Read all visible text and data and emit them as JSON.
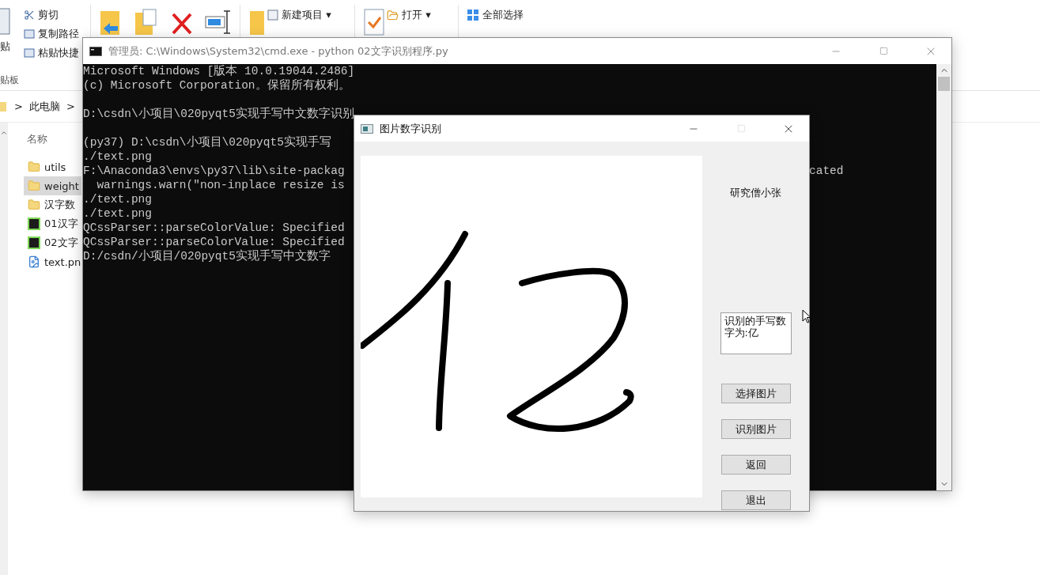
{
  "explorer": {
    "ribbon": {
      "paste_label": "贴",
      "clipboard_items": [
        "剪切",
        "复制路径",
        "粘贴快捷"
      ],
      "clipboard_group": "贴板",
      "new_items": [
        "新建项目 ▾"
      ],
      "open_item": "打开 ▾",
      "select_items": [
        "全部选择"
      ]
    },
    "breadcrumb": [
      ">",
      "此电脑",
      ">"
    ],
    "column_header": "名称",
    "files": [
      {
        "name": "utils",
        "kind": "folder",
        "selected": false
      },
      {
        "name": "weight",
        "kind": "folder",
        "selected": true
      },
      {
        "name": "汉字数",
        "kind": "folder",
        "selected": false
      },
      {
        "name": "01汉字",
        "kind": "script",
        "selected": false
      },
      {
        "name": "02文字",
        "kind": "script",
        "selected": false
      },
      {
        "name": "text.pn",
        "kind": "image",
        "selected": false
      }
    ]
  },
  "cmd": {
    "title": "管理员: C:\\Windows\\System32\\cmd.exe - python  02文字识别程序.py",
    "blocks": [
      [
        {
          "text": "Microsoft Windows [版本 10.0.19044.2486]"
        },
        {
          "text": "(c) Microsoft Corporation。保留所有权利。"
        }
      ],
      [
        {
          "text": "D:\\csdn\\小项目\\020pyqt5实现手写中文数字识别"
        }
      ],
      [
        {
          "text": "(py37) D:\\csdn\\小项目\\020pyqt5实现手写"
        },
        {
          "text": "./text.png"
        },
        {
          "text": "F:\\Anaconda3\\envs\\py37\\lib\\site-packag",
          "tail": "cated"
        },
        {
          "text": "  warnings.warn(\"non-inplace resize is"
        },
        {
          "text": "./text.png"
        },
        {
          "text": "./text.png"
        },
        {
          "text": "QCssParser::parseColorValue: Specified"
        },
        {
          "text": "QCssParser::parseColorValue: Specified"
        },
        {
          "text": "D:/csdn/小项目/020pyqt5实现手写中文数字"
        }
      ]
    ]
  },
  "app": {
    "title": "图片数字识别",
    "author": "研究僧小张",
    "result": "识别的手写数字为:亿",
    "buttons": [
      "选择图片",
      "识别图片",
      "返回",
      "退出"
    ]
  }
}
